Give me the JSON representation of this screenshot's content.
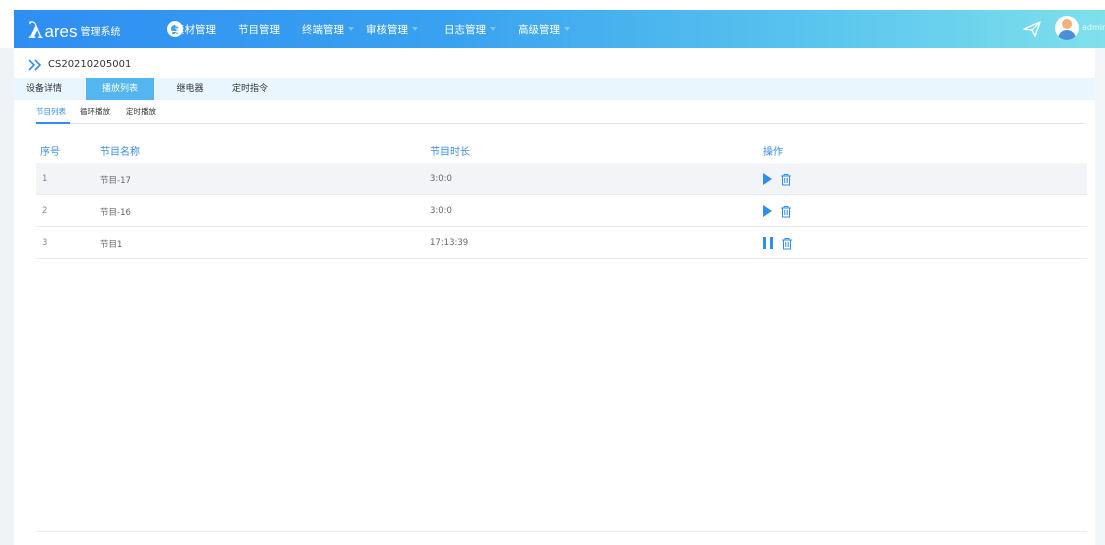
{
  "header": {
    "logo_mark": "λ",
    "logo_word": "ares",
    "logo_sub": "管理系统",
    "nav": [
      {
        "label": "素材管理"
      },
      {
        "label": "节目管理"
      },
      {
        "label": "终端管理"
      },
      {
        "label": "审核管理"
      },
      {
        "label": "日志管理"
      },
      {
        "label": "高级管理"
      }
    ],
    "user": "admin"
  },
  "device": {
    "id": "CS20210205001"
  },
  "tabs": [
    {
      "label": "设备详情"
    },
    {
      "label": "播放列表",
      "active": true
    },
    {
      "label": "继电器"
    },
    {
      "label": "定时指令"
    }
  ],
  "subtabs": [
    {
      "label": "节目列表",
      "active": true
    },
    {
      "label": "循环播放"
    },
    {
      "label": "定时播放"
    }
  ],
  "table": {
    "columns": [
      "序号",
      "节目名称",
      "节目时长",
      "操作"
    ],
    "rows": [
      {
        "index": "1",
        "name": "节目-17",
        "duration": "3:0:0",
        "state": "play"
      },
      {
        "index": "2",
        "name": "节目-16",
        "duration": "3:0:0",
        "state": "play"
      },
      {
        "index": "3",
        "name": "节目1",
        "duration": "17:13:39",
        "state": "pause"
      }
    ]
  },
  "colors": {
    "accent": "#2f8ef2",
    "header_gradient_start": "#2f8ef2",
    "header_gradient_end": "#7fe0ec",
    "active_tab": "#53b6ee"
  },
  "icons": [
    "home-icon",
    "send-icon",
    "avatar",
    "double-chevron-icon",
    "play-icon",
    "pause-icon",
    "trash-icon"
  ]
}
